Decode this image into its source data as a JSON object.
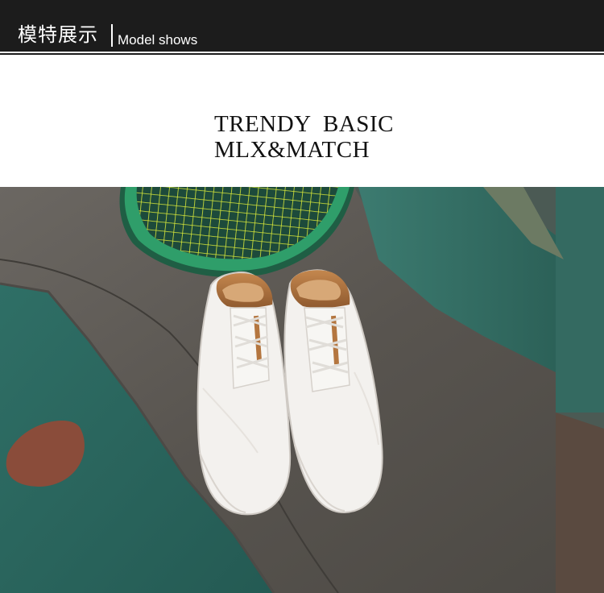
{
  "header": {
    "title_cn": "模特展示",
    "title_en": "Model shows"
  },
  "tagline": {
    "line1": "TRENDY  BASIC",
    "line2": "MLX&MATCH"
  },
  "photo": {
    "subject": "white lace-up sneakers with tan lining",
    "props": [
      "green tennis racket",
      "teal painted pavement",
      "teal metal post"
    ]
  },
  "colors": {
    "header_bg": "#1c1c1c",
    "racket_frame": "#2f9e6a",
    "racket_strings": "#d8e83a",
    "pavement": "#5e5a55",
    "teal_paint": "#2f6b62",
    "shoe_white": "#f3f1ee",
    "shoe_lining": "#b4763f"
  }
}
